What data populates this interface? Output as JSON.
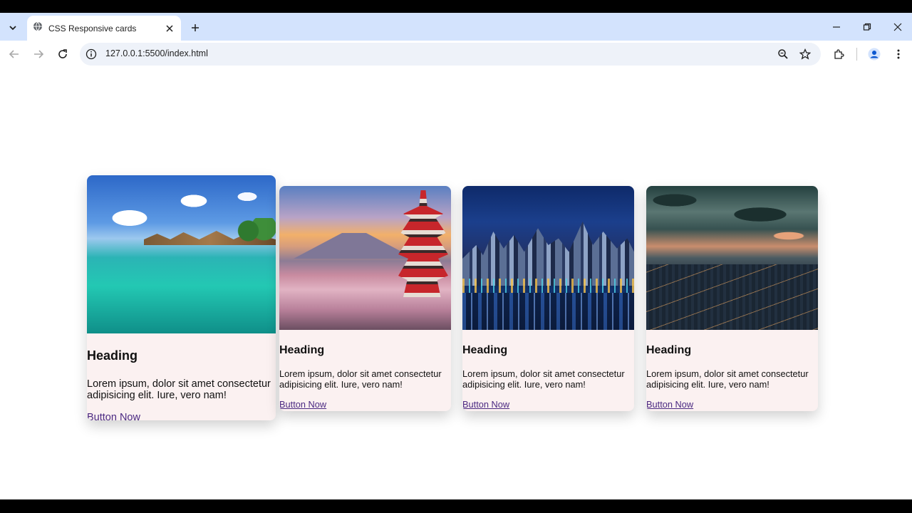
{
  "browser": {
    "tab_title": "CSS Responsive cards",
    "url": "127.0.0.1:5500/index.html"
  },
  "cards": [
    {
      "heading": "Heading",
      "text": "Lorem ipsum, dolor sit amet consectetur adipisicing elit. Iure, vero nam!",
      "button": "Button Now",
      "image": "tropical-overwater-bungalows"
    },
    {
      "heading": "Heading",
      "text": "Lorem ipsum, dolor sit amet consectetur adipisicing elit. Iure, vero nam!",
      "button": "Button Now",
      "image": "pagoda-cherry-blossoms"
    },
    {
      "heading": "Heading",
      "text": "Lorem ipsum, dolor sit amet consectetur adipisicing elit. Iure, vero nam!",
      "button": "Button Now",
      "image": "city-skyline-night"
    },
    {
      "heading": "Heading",
      "text": "Lorem ipsum, dolor sit amet consectetur adipisicing elit. Iure, vero nam!",
      "button": "Button Now",
      "image": "city-dusk-aerial"
    }
  ],
  "colors": {
    "tabstrip": "#d3e3fd",
    "card_bg": "#fbf1f1",
    "link": "#4b2a82"
  }
}
